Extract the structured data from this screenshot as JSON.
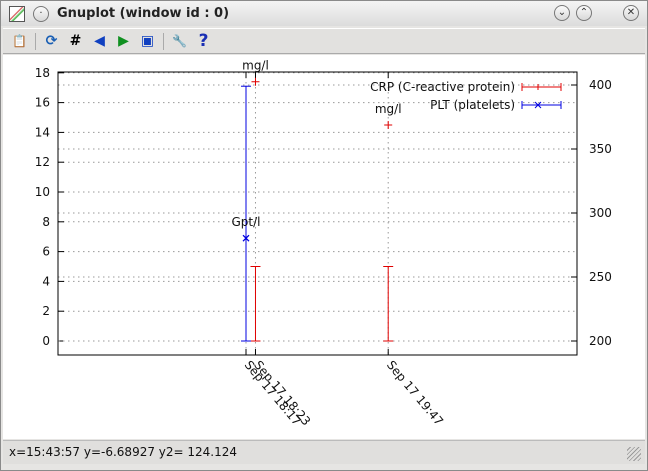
{
  "window": {
    "title": "Gnuplot (window id : 0)"
  },
  "toolbar": {
    "icons": [
      "copy-to-clipboard-icon",
      "replot-icon",
      "grid-icon",
      "previous-zoom-icon",
      "next-zoom-icon",
      "autoscale-icon",
      "settings-icon",
      "help-icon"
    ],
    "glyphs": [
      "📋",
      "⟳",
      "#",
      "◀",
      "▶",
      "▣",
      "🔧",
      "?"
    ]
  },
  "status": {
    "text": "x=15:43:57 y=-6.68927 y2= 124.124"
  },
  "colors": {
    "crp": "#e00000",
    "plt": "#0000e0"
  },
  "chart_data": {
    "type": "scatter",
    "x_unit": "minutes since Sep 17 00:00",
    "xlim": [
      977,
      1307
    ],
    "ylim": [
      -1,
      18.5
    ],
    "y_ticks": [
      0,
      2,
      4,
      6,
      8,
      10,
      12,
      14,
      16,
      18
    ],
    "y2lim": [
      195,
      422
    ],
    "y2_ticks": [
      200,
      250,
      300,
      350,
      400
    ],
    "x_ticks": [
      {
        "x": 1097,
        "label": "Sep 17 18:17"
      },
      {
        "x": 1103,
        "label": "Sep 17 18:23"
      },
      {
        "x": 1187,
        "label": "Sep 17 19:47"
      }
    ],
    "grid": true,
    "legend": "top-right",
    "series": [
      {
        "name": "CRP (C-reactive protein)",
        "color": "#e00000",
        "marker": "+",
        "points": [
          {
            "x": 1103,
            "y": 17.4,
            "err": [
              0,
              5
            ],
            "label": "mg/l"
          },
          {
            "x": 1187,
            "y": 14.5,
            "err": [
              0,
              5
            ],
            "label": "mg/l"
          }
        ]
      },
      {
        "name": "PLT (platelets)",
        "color": "#0000e0",
        "marker": "x",
        "points": [
          {
            "x": 1097,
            "y": 6.9,
            "err": [
              0,
              17.1
            ],
            "label": "Gpt/l"
          }
        ]
      }
    ]
  }
}
